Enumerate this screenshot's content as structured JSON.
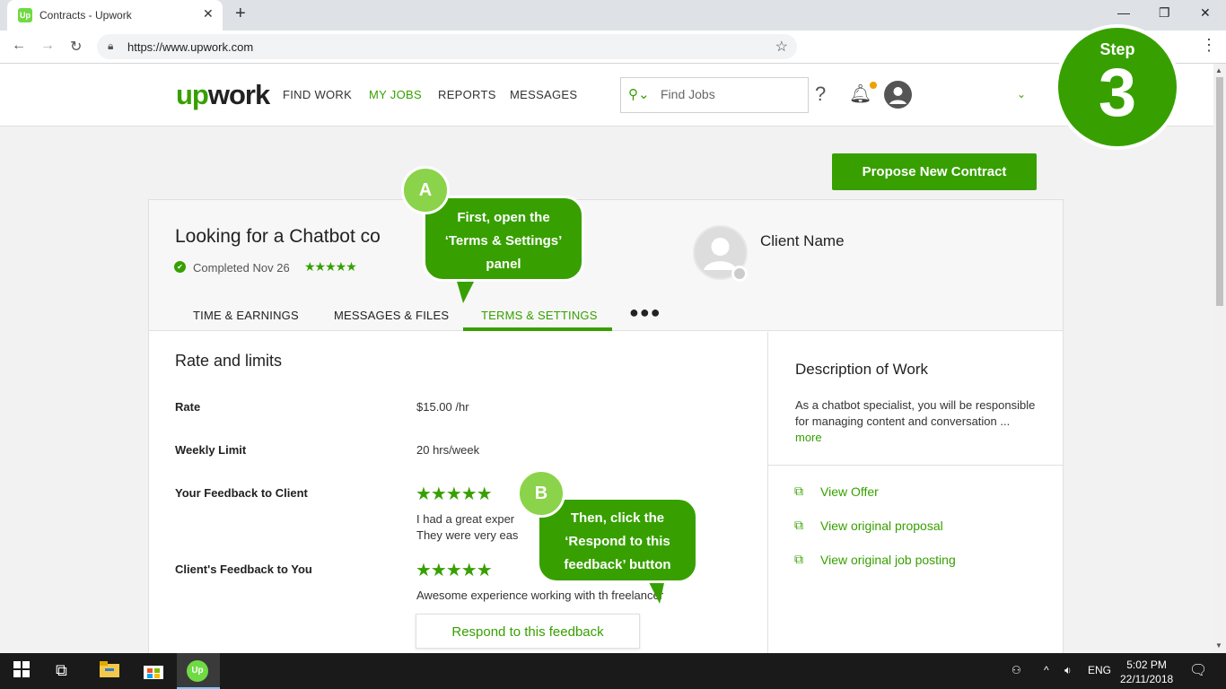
{
  "browser": {
    "tab_title": "Contracts - Upwork",
    "tab_icon_text": "Up",
    "url": "https://www.upwork.com"
  },
  "header": {
    "logo_up": "up",
    "logo_work": "work",
    "nav": [
      "FIND WORK",
      "MY JOBS",
      "REPORTS",
      "MESSAGES"
    ],
    "active_nav": "MY JOBS",
    "search_placeholder": "Find Jobs",
    "help": "?"
  },
  "step_badge": {
    "label": "Step",
    "number": "3"
  },
  "propose_button": "Propose New Contract",
  "contract": {
    "title": "Looking for a Chatbot co",
    "status": "Completed Nov 26",
    "rating_stars": 5,
    "client_name": "Client Name",
    "tabs": [
      "TIME & EARNINGS",
      "MESSAGES & FILES",
      "TERMS & SETTINGS"
    ],
    "active_tab": "TERMS & SETTINGS",
    "more": "●●●"
  },
  "rate_section": {
    "heading": "Rate and limits",
    "rate_label": "Rate",
    "rate_value": "$15.00 /hr",
    "limit_label": "Weekly Limit",
    "limit_value": "20 hrs/week",
    "your_feedback_label": "Your Feedback to Client",
    "your_feedback_stars": 5,
    "your_feedback_line1": "I had a great exper",
    "your_feedback_line2": "They were very eas",
    "client_feedback_label": "Client's Feedback to You",
    "client_feedback_stars": 5,
    "client_feedback_text": "Awesome experience working with th  freelancer",
    "respond_button": "Respond to this feedback"
  },
  "description": {
    "heading": "Description of Work",
    "text": "As a chatbot specialist, you will be responsible for managing content and conversation ...",
    "more_link": "more",
    "links": [
      "View Offer",
      "View original proposal",
      "View original job posting"
    ]
  },
  "callouts": {
    "a_badge": "A",
    "a_line1": "First, open the",
    "a_line2": "‘Terms & Settings’",
    "a_line3": "panel",
    "b_badge": "B",
    "b_line1": "Then, click the",
    "b_line2": "‘Respond to this",
    "b_line3": "feedback’ button"
  },
  "taskbar": {
    "language": "ENG",
    "time": "5:02 PM",
    "date": "22/11/2018",
    "app_icon_text": "Up"
  },
  "colors": {
    "brand": "#37a000",
    "badge": "#8bd34a",
    "taskbar": "#1a1a1a"
  }
}
